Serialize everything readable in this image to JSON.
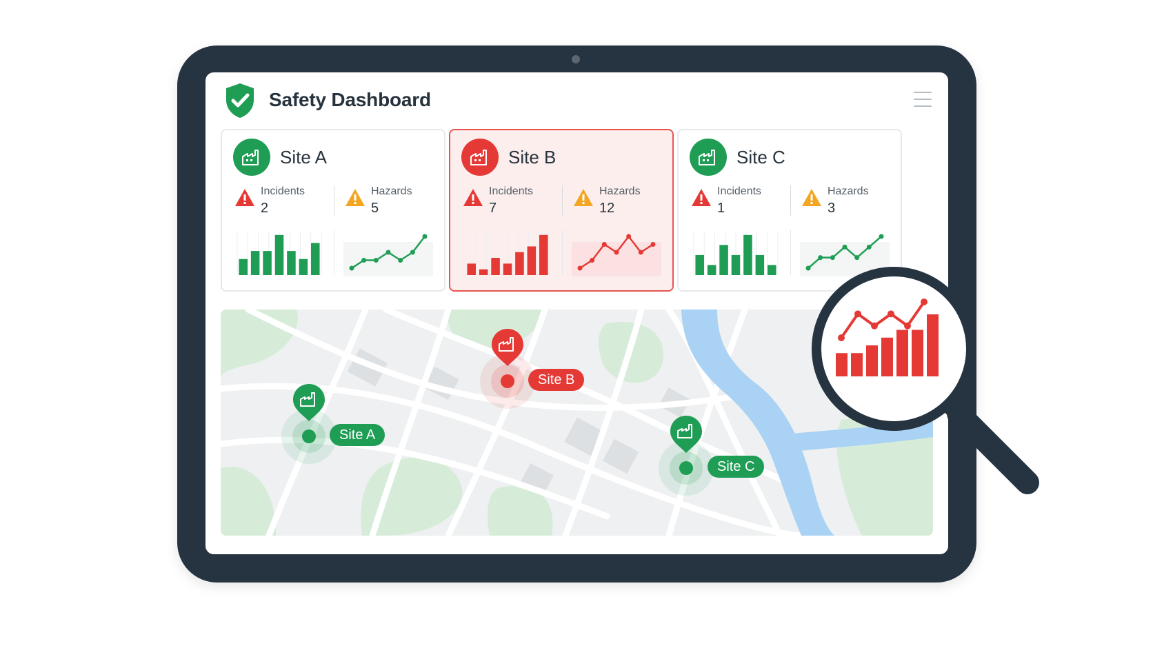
{
  "header": {
    "title": "Safety Dashboard"
  },
  "colors": {
    "safe": "#1f9d55",
    "alert": "#e53935",
    "warning": "#f4a521",
    "water": "#a9d2f5",
    "park": "#d6ecd9"
  },
  "sites": [
    {
      "name": "Site A",
      "status": "safe",
      "incidents_label": "Incidents",
      "incidents": "2",
      "hazards_label": "Hazards",
      "hazards": "5"
    },
    {
      "name": "Site B",
      "status": "alert",
      "incidents_label": "Incidents",
      "incidents": "7",
      "hazards_label": "Hazards",
      "hazards": "12"
    },
    {
      "name": "Site C",
      "status": "safe",
      "incidents_label": "Incidents",
      "incidents": "1",
      "hazards_label": "Hazards",
      "hazards": "3"
    }
  ],
  "map": {
    "pins": [
      {
        "label": "Site A",
        "status": "safe"
      },
      {
        "label": "Site B",
        "status": "alert"
      },
      {
        "label": "Site C",
        "status": "safe"
      }
    ]
  },
  "chart_data": [
    {
      "type": "bar",
      "site": "Site A",
      "values": [
        2,
        3,
        3,
        5,
        3,
        2,
        4
      ]
    },
    {
      "type": "line",
      "site": "Site A",
      "values": [
        2,
        3,
        3,
        4,
        3,
        4,
        6
      ]
    },
    {
      "type": "bar",
      "site": "Site B",
      "values": [
        2,
        1,
        3,
        2,
        4,
        5,
        7
      ]
    },
    {
      "type": "line",
      "site": "Site B",
      "values": [
        2,
        3,
        5,
        4,
        6,
        4,
        5
      ]
    },
    {
      "type": "bar",
      "site": "Site C",
      "values": [
        2,
        1,
        3,
        2,
        4,
        2,
        1
      ]
    },
    {
      "type": "line",
      "site": "Site C",
      "values": [
        1,
        2,
        2,
        3,
        2,
        3,
        4
      ]
    },
    {
      "type": "bar",
      "site": "Magnified (Site B)",
      "values": [
        3,
        3,
        4,
        5,
        6,
        6,
        8
      ]
    },
    {
      "type": "line",
      "site": "Magnified (Site B)",
      "values": [
        4,
        6,
        5,
        6,
        5,
        7
      ]
    }
  ]
}
